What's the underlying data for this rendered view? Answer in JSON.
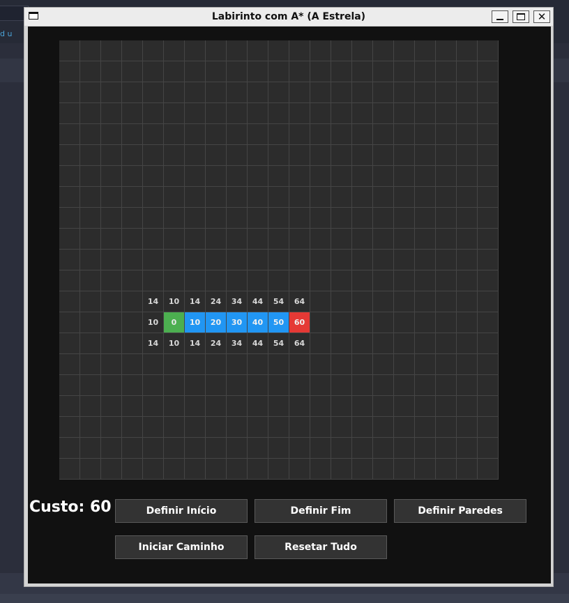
{
  "window": {
    "title": "Labirinto com A* (A Estrela)",
    "icons": {
      "app": "window-icon",
      "minimize": "minimize-icon",
      "maximize": "maximize-icon",
      "close": "close-icon"
    },
    "close_glyph": "✕"
  },
  "background": {
    "partial_text": "d u"
  },
  "grid": {
    "cols": 21,
    "rows": 21,
    "colors": {
      "empty": "#2c2c2c",
      "start": "#4caf50",
      "path": "#2196f3",
      "end": "#e53935",
      "line": "#454545"
    },
    "labeled_cells": [
      {
        "row": 12,
        "col": 4,
        "text": "14",
        "type": "open"
      },
      {
        "row": 12,
        "col": 5,
        "text": "10",
        "type": "open"
      },
      {
        "row": 12,
        "col": 6,
        "text": "14",
        "type": "open"
      },
      {
        "row": 12,
        "col": 7,
        "text": "24",
        "type": "open"
      },
      {
        "row": 12,
        "col": 8,
        "text": "34",
        "type": "open"
      },
      {
        "row": 12,
        "col": 9,
        "text": "44",
        "type": "open"
      },
      {
        "row": 12,
        "col": 10,
        "text": "54",
        "type": "open"
      },
      {
        "row": 12,
        "col": 11,
        "text": "64",
        "type": "open"
      },
      {
        "row": 13,
        "col": 4,
        "text": "10",
        "type": "open"
      },
      {
        "row": 13,
        "col": 5,
        "text": "0",
        "type": "start"
      },
      {
        "row": 13,
        "col": 6,
        "text": "10",
        "type": "path"
      },
      {
        "row": 13,
        "col": 7,
        "text": "20",
        "type": "path"
      },
      {
        "row": 13,
        "col": 8,
        "text": "30",
        "type": "path"
      },
      {
        "row": 13,
        "col": 9,
        "text": "40",
        "type": "path"
      },
      {
        "row": 13,
        "col": 10,
        "text": "50",
        "type": "path"
      },
      {
        "row": 13,
        "col": 11,
        "text": "60",
        "type": "end"
      },
      {
        "row": 14,
        "col": 4,
        "text": "14",
        "type": "open"
      },
      {
        "row": 14,
        "col": 5,
        "text": "10",
        "type": "open"
      },
      {
        "row": 14,
        "col": 6,
        "text": "14",
        "type": "open"
      },
      {
        "row": 14,
        "col": 7,
        "text": "24",
        "type": "open"
      },
      {
        "row": 14,
        "col": 8,
        "text": "34",
        "type": "open"
      },
      {
        "row": 14,
        "col": 9,
        "text": "44",
        "type": "open"
      },
      {
        "row": 14,
        "col": 10,
        "text": "54",
        "type": "open"
      },
      {
        "row": 14,
        "col": 11,
        "text": "64",
        "type": "open"
      }
    ]
  },
  "status": {
    "cost_label": "Custo: 60"
  },
  "buttons": {
    "set_start": "Definir Início",
    "set_end": "Definir Fim",
    "set_walls": "Definir Paredes",
    "start_path": "Iniciar Caminho",
    "reset_all": "Resetar Tudo"
  }
}
